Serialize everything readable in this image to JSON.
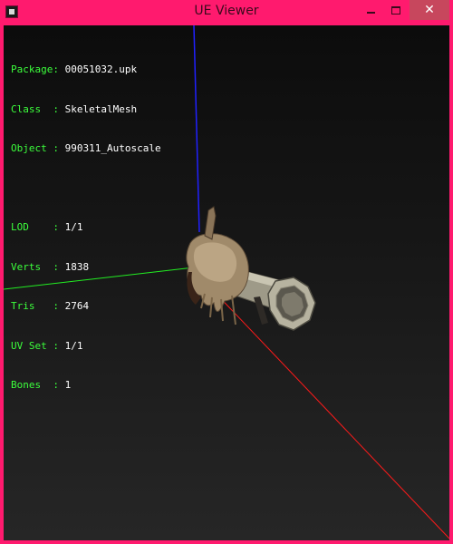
{
  "window": {
    "title": "UE Viewer",
    "buttons": {
      "minimize": "minimize",
      "maximize": "maximize",
      "close": "✕"
    }
  },
  "info": {
    "object_block": [
      {
        "key": "Package:",
        "value": "00051032.upk"
      },
      {
        "key": "Class  :",
        "value": "SkeletalMesh"
      },
      {
        "key": "Object :",
        "value": "990311_Autoscale"
      }
    ],
    "stats_block": [
      {
        "key": "LOD    :",
        "value": "1/1"
      },
      {
        "key": "Verts  :",
        "value": "1838"
      },
      {
        "key": "Tris   :",
        "value": "2764"
      },
      {
        "key": "UV Set :",
        "value": "1/1"
      },
      {
        "key": "Bones  :",
        "value": "1"
      }
    ]
  },
  "colors": {
    "frame": "#ff1a6e",
    "close_button": "#c7475d",
    "label_text": "#3cff3c",
    "value_text": "#ffffff",
    "axis_x": "#ff1a1a",
    "axis_y": "#22ee22",
    "axis_z": "#2020ff"
  },
  "icons": {
    "app": "ue-viewer-app-icon",
    "minimize": "minimize-icon",
    "maximize": "maximize-icon",
    "close": "close-icon"
  }
}
